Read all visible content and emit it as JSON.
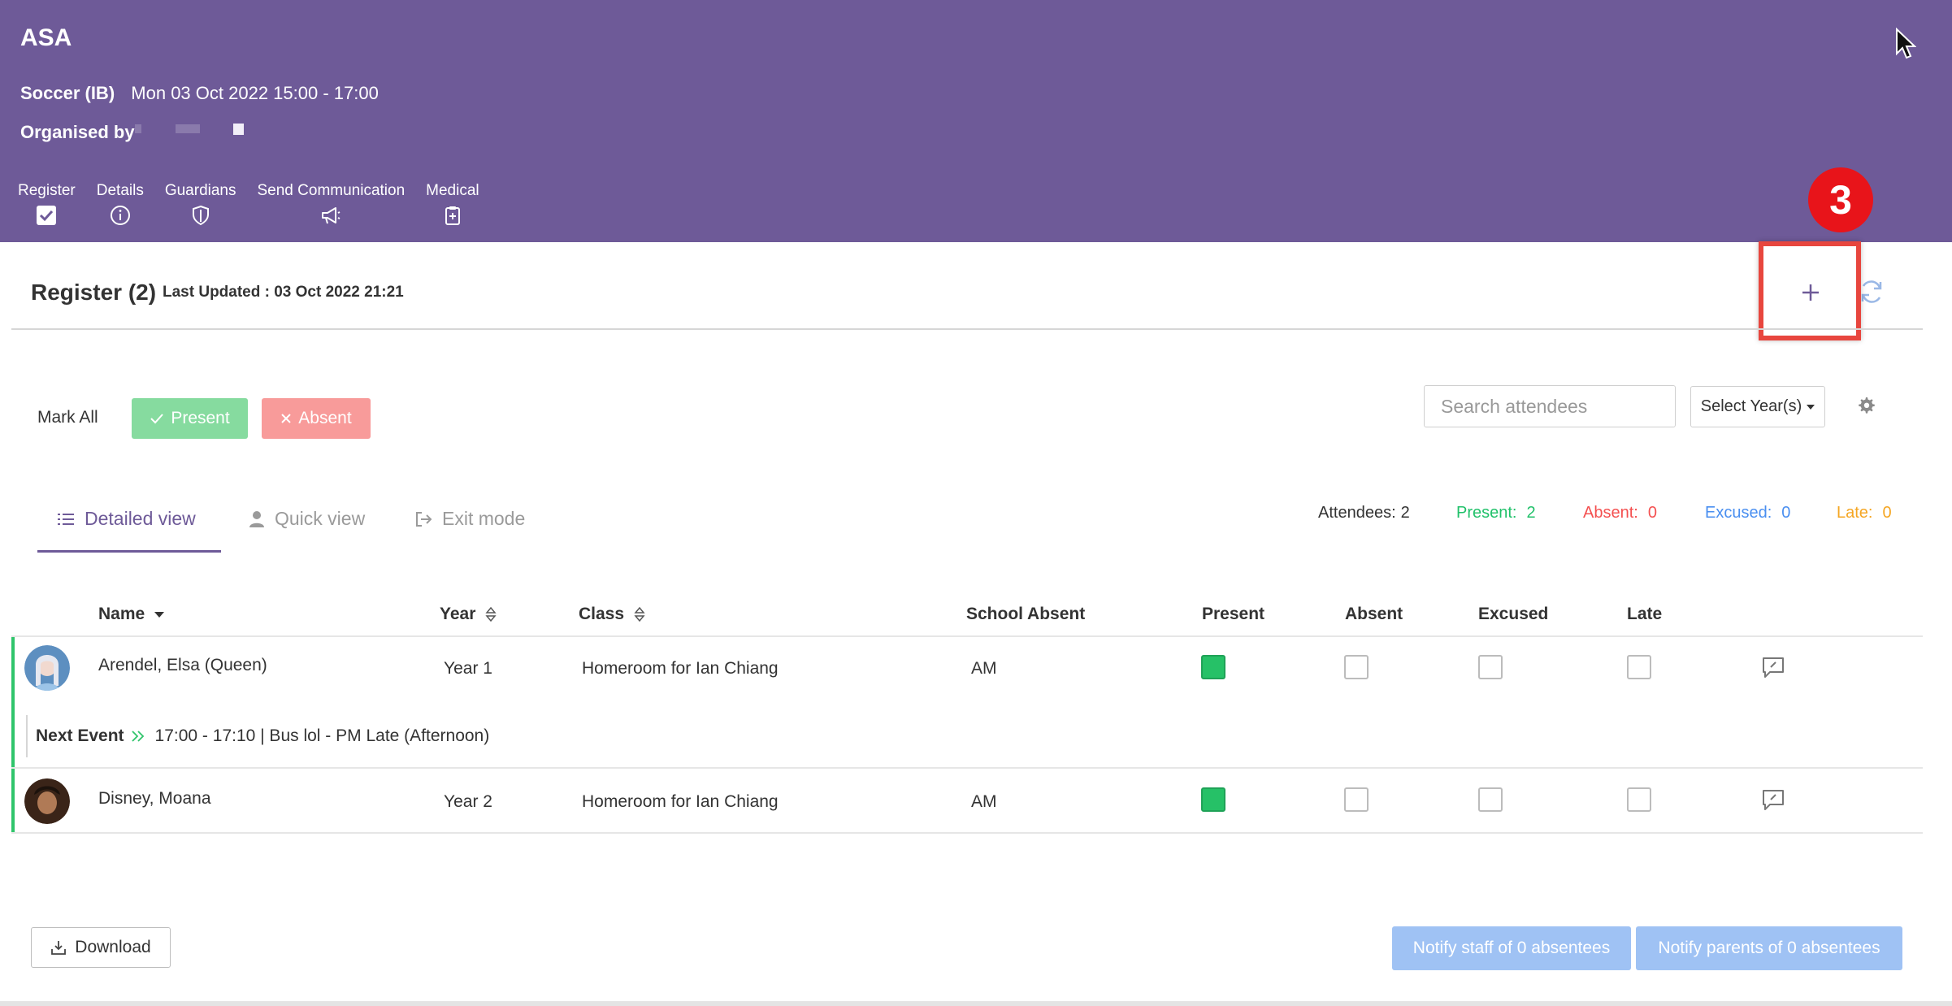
{
  "header": {
    "app_title": "ASA",
    "activity": "Soccer (IB)",
    "datetime": "Mon 03 Oct 2022 15:00 - 17:00",
    "organised_by_label": "Organised by",
    "tabs": [
      {
        "label": "Register",
        "icon": "checkbox-icon",
        "active": true
      },
      {
        "label": "Details",
        "icon": "info-icon"
      },
      {
        "label": "Guardians",
        "icon": "shield-icon"
      },
      {
        "label": "Send Communication",
        "icon": "megaphone-icon"
      },
      {
        "label": "Medical",
        "icon": "medical-clipboard-icon"
      }
    ]
  },
  "annotation": {
    "step_number": "3",
    "color": "#e8141a"
  },
  "register": {
    "title": "Register (2)",
    "last_updated": "Last Updated : 03 Oct 2022 21:21"
  },
  "mark_all": {
    "label": "Mark All",
    "present_label": "Present",
    "absent_label": "Absent"
  },
  "filters": {
    "search_placeholder": "Search attendees",
    "year_select": "Select Year(s)"
  },
  "views": {
    "detailed": "Detailed view",
    "quick": "Quick view",
    "exit": "Exit mode"
  },
  "stats": {
    "attendees_label": "Attendees:",
    "attendees": "2",
    "present_label": "Present:",
    "present": "2",
    "absent_label": "Absent:",
    "absent": "0",
    "excused_label": "Excused:",
    "excused": "0",
    "late_label": "Late:",
    "late": "0"
  },
  "table": {
    "columns": {
      "name": "Name",
      "year": "Year",
      "class": "Class",
      "school_absent": "School Absent",
      "present": "Present",
      "absent": "Absent",
      "excused": "Excused",
      "late": "Late"
    },
    "rows": [
      {
        "name": "Arendel, Elsa (Queen)",
        "year": "Year 1",
        "class": "Homeroom for Ian Chiang",
        "school_absent": "AM",
        "present": true,
        "absent": false,
        "excused": false,
        "late": false
      },
      {
        "name": "Disney, Moana",
        "year": "Year 2",
        "class": "Homeroom for Ian Chiang",
        "school_absent": "AM",
        "present": true,
        "absent": false,
        "excused": false,
        "late": false
      }
    ],
    "next_event": {
      "label": "Next Event",
      "text": "17:00 - 17:10 | Bus lol - PM Late (Afternoon)"
    }
  },
  "footer": {
    "download": "Download",
    "notify_staff": "Notify staff of 0 absentees",
    "notify_parents": "Notify parents of 0 absentees"
  },
  "colors": {
    "header_bg": "#6e5a98",
    "present_green": "#21c16a",
    "absent_red": "#f45050",
    "excused_blue": "#4a8ff0",
    "late_orange": "#f5a623"
  }
}
